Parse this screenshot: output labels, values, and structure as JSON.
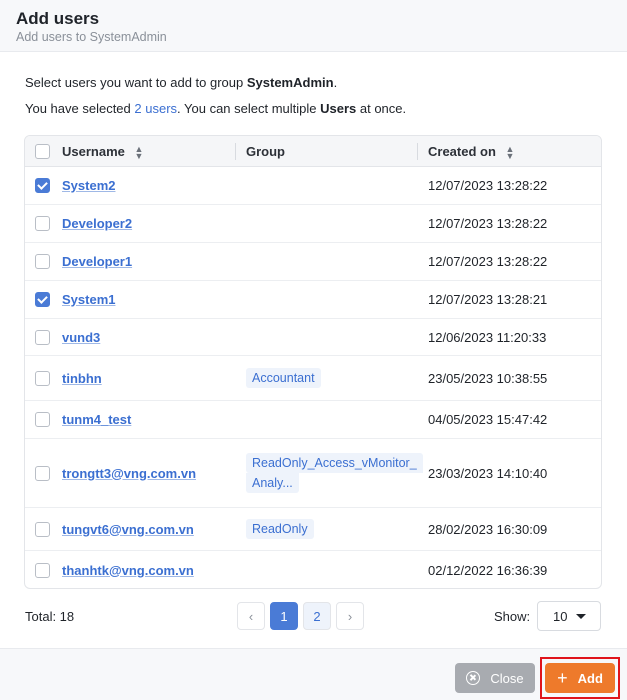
{
  "dialog": {
    "title": "Add users",
    "subtitle": "Add users to SystemAdmin"
  },
  "intro": {
    "line1_prefix": "Select users you want to add to group ",
    "group_name": "SystemAdmin",
    "line1_suffix": ".",
    "line2_prefix": "You have selected ",
    "selected_link": "2 users",
    "line2_middle": ". You can select multiple ",
    "line2_bold": "Users",
    "line2_suffix": " at once."
  },
  "table": {
    "headers": {
      "username": "Username",
      "group": "Group",
      "created_on": "Created on"
    },
    "rows": [
      {
        "username": "System2",
        "group": "",
        "created_on": "12/07/2023 13:28:22",
        "checked": true
      },
      {
        "username": "Developer2",
        "group": "",
        "created_on": "12/07/2023 13:28:22",
        "checked": false
      },
      {
        "username": "Developer1",
        "group": "",
        "created_on": "12/07/2023 13:28:22",
        "checked": false
      },
      {
        "username": "System1",
        "group": "",
        "created_on": "12/07/2023 13:28:21",
        "checked": true
      },
      {
        "username": "vund3",
        "group": "",
        "created_on": "12/06/2023 11:20:33",
        "checked": false
      },
      {
        "username": "tinbhn",
        "group": "Accountant",
        "created_on": "23/05/2023 10:38:55",
        "checked": false
      },
      {
        "username": "tunm4_test",
        "group": "",
        "created_on": "04/05/2023 15:47:42",
        "checked": false
      },
      {
        "username": "trongtt3@vng.com.vn",
        "group": "ReadOnly_Access_vMonitor_",
        "group_line2": "Analy...",
        "created_on": "23/03/2023 14:10:40",
        "checked": false
      },
      {
        "username": "tungvt6@vng.com.vn",
        "group": "ReadOnly",
        "created_on": "28/02/2023 16:30:09",
        "checked": false
      },
      {
        "username": "thanhtk@vng.com.vn",
        "group": "",
        "created_on": "02/12/2022 16:36:39",
        "checked": false
      }
    ]
  },
  "pagination": {
    "total_label": "Total: 18",
    "prev": "‹",
    "pages": [
      "1",
      "2"
    ],
    "current_page": "1",
    "next": "›",
    "show_label": "Show:",
    "page_size": "10"
  },
  "footer": {
    "close_label": "Close",
    "add_label": "Add"
  },
  "icons": {
    "sort": "sort-icon",
    "close": "close-circle-icon",
    "add": "plus-icon",
    "dropdown": "caret-down-icon"
  },
  "colors": {
    "accent": "#4a7bd6",
    "add_button": "#ee7a2b",
    "close_button": "#a8abb0",
    "highlight_frame": "#e0141b"
  }
}
